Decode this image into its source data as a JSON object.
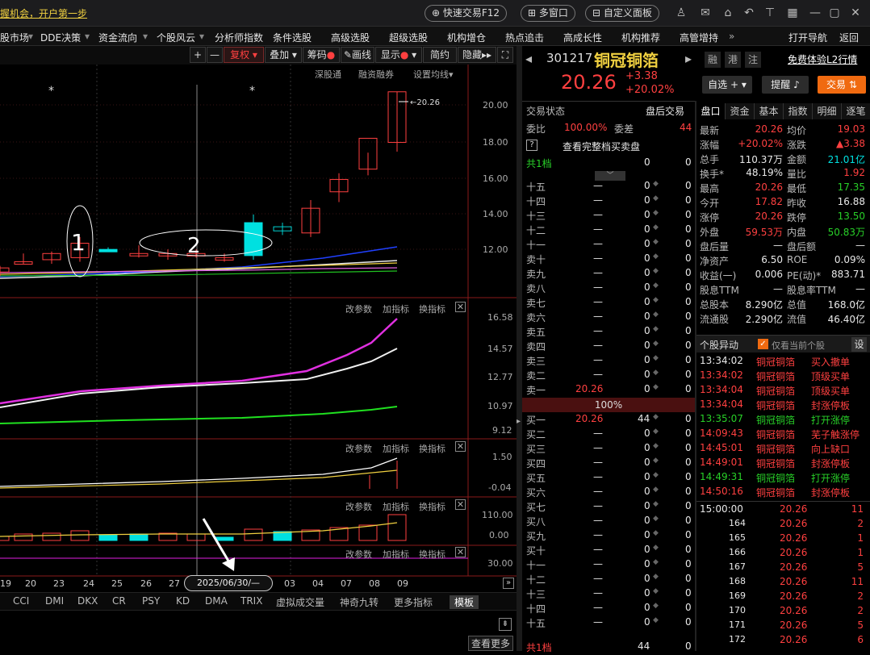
{
  "topbar": {
    "ad": "握机会，开户第一步",
    "fast_trade": "快速交易F12",
    "multi_window": "多窗口",
    "custom_panel": "自定义面板"
  },
  "menu": [
    "股市场",
    "DDE决策",
    "资金流向",
    "个股风云",
    "分析师指数",
    "条件选股",
    "高级选股",
    "超级选股",
    "机构增仓",
    "热点追击",
    "高成长性",
    "机构推荐",
    "高管增持",
    "打开导航",
    "返回"
  ],
  "chart_toolbar": {
    "plus": "+",
    "minus": "—",
    "fuquan": "复权",
    "diejia": "叠加",
    "chouma": "筹码",
    "huaxian": "画线",
    "xianshi": "显示",
    "jianyue": "简约",
    "yincang": "隐藏"
  },
  "chart_links": {
    "shengutong": "深股通",
    "rongzi": "融资融券",
    "junxian": "设置均线"
  },
  "pane_btns": {
    "gai": "改参数",
    "jia": "加指标",
    "huan": "换指标"
  },
  "price_labels": [
    "20.00",
    "18.00",
    "16.00",
    "14.00",
    "12.00"
  ],
  "last_price_label": "20.26",
  "ind1_labels": [
    "16.58",
    "14.57",
    "12.77",
    "10.97",
    "9.12"
  ],
  "ind2_labels": [
    "1.50",
    "-0.04"
  ],
  "ind3_labels": [
    "110.00",
    "0.00"
  ],
  "ind4_labels": [
    "30.00"
  ],
  "annotations": {
    "one": "1",
    "two": "2",
    "star": "*"
  },
  "x_axis": [
    "19",
    "20",
    "23",
    "24",
    "25",
    "26",
    "27",
    "03",
    "04",
    "07",
    "08",
    "09"
  ],
  "cursor_date": "2025/06/30/—",
  "indicators": [
    "CCI",
    "DMI",
    "DKX",
    "CR",
    "PSY",
    "KD",
    "DMA",
    "TRIX",
    "虚拟成交量",
    "神奇九转",
    "更多指标",
    "模板"
  ],
  "more": "查看更多",
  "stock": {
    "code": "301217",
    "name": "铜冠铜箔",
    "price": "20.26",
    "change": "+3.38",
    "pct": "+20.02%",
    "tags": [
      "融",
      "港",
      "注"
    ],
    "l2": "免费体验L2行情",
    "zixuan": "自选",
    "tixing": "提醒",
    "jiaoyi": "交易"
  },
  "ob": {
    "status_lbl": "交易状态",
    "status": "盘后交易",
    "weibi_lbl": "委比",
    "weibi": "100.00%",
    "weicha_lbl": "委差",
    "weicha": "44",
    "full": "查看完整档买卖盘",
    "gong1": "共1档",
    "ratio": "100%",
    "gong1b": "共1档",
    "asks": [
      [
        "十五",
        "—",
        "0"
      ],
      [
        "十四",
        "—",
        "0"
      ],
      [
        "十三",
        "—",
        "0"
      ],
      [
        "十二",
        "—",
        "0"
      ],
      [
        "十一",
        "—",
        "0"
      ],
      [
        "卖十",
        "—",
        "0"
      ],
      [
        "卖九",
        "—",
        "0"
      ],
      [
        "卖八",
        "—",
        "0"
      ],
      [
        "卖七",
        "—",
        "0"
      ],
      [
        "卖六",
        "—",
        "0"
      ],
      [
        "卖五",
        "—",
        "0"
      ],
      [
        "卖四",
        "—",
        "0"
      ],
      [
        "卖三",
        "—",
        "0"
      ],
      [
        "卖二",
        "—",
        "0"
      ],
      [
        "卖一",
        "20.26",
        "0"
      ]
    ],
    "bids": [
      [
        "买一",
        "20.26",
        "44"
      ],
      [
        "买二",
        "—",
        "0"
      ],
      [
        "买三",
        "—",
        "0"
      ],
      [
        "买四",
        "—",
        "0"
      ],
      [
        "买五",
        "—",
        "0"
      ],
      [
        "买六",
        "—",
        "0"
      ],
      [
        "买七",
        "—",
        "0"
      ],
      [
        "买八",
        "—",
        "0"
      ],
      [
        "买九",
        "—",
        "0"
      ],
      [
        "买十",
        "—",
        "0"
      ],
      [
        "十一",
        "—",
        "0"
      ],
      [
        "十二",
        "—",
        "0"
      ],
      [
        "十三",
        "—",
        "0"
      ],
      [
        "十四",
        "—",
        "0"
      ],
      [
        "十五",
        "—",
        "0"
      ]
    ]
  },
  "quote_tabs": [
    "盘口",
    "资金",
    "基本",
    "指数",
    "明细",
    "逐笔"
  ],
  "quote": [
    [
      "最新",
      "20.26",
      "均价",
      "19.03"
    ],
    [
      "涨幅",
      "+20.02%",
      "涨跌",
      "▲3.38"
    ],
    [
      "总手",
      "110.37万",
      "金额",
      "21.01亿"
    ],
    [
      "换手*",
      "48.19%",
      "量比",
      "1.92"
    ],
    [
      "最高",
      "20.26",
      "最低",
      "17.35"
    ],
    [
      "今开",
      "17.82",
      "昨收",
      "16.88"
    ],
    [
      "涨停",
      "20.26",
      "跌停",
      "13.50"
    ],
    [
      "外盘",
      "59.53万",
      "内盘",
      "50.83万"
    ],
    [
      "盘后量",
      "—",
      "盘后额",
      "—"
    ],
    [
      "净资产",
      "6.50",
      "ROE",
      "0.09%"
    ],
    [
      "收益(一)",
      "0.006",
      "PE(动)*",
      "883.71"
    ],
    [
      "股息TTM",
      "—",
      "股息率TTM",
      "—"
    ],
    [
      "总股本",
      "8.290亿",
      "总值",
      "168.0亿"
    ],
    [
      "流通股",
      "2.290亿",
      "流值",
      "46.40亿"
    ]
  ],
  "movers": {
    "title": "个股异动",
    "only": "仅看当前个股",
    "set": "设",
    "rows": [
      [
        "13:34:02",
        "铜冠铜箔",
        "买入撤单"
      ],
      [
        "13:34:02",
        "铜冠铜箔",
        "顶级买单"
      ],
      [
        "13:34:04",
        "铜冠铜箔",
        "顶级买单"
      ],
      [
        "13:34:04",
        "铜冠铜箔",
        "封涨停板"
      ],
      [
        "13:35:07",
        "铜冠铜箔",
        "打开涨停"
      ],
      [
        "14:09:43",
        "铜冠铜箔",
        "芜子触涨停"
      ],
      [
        "14:45:01",
        "铜冠铜箔",
        "向上缺口"
      ],
      [
        "14:49:01",
        "铜冠铜箔",
        "封涨停板"
      ],
      [
        "14:49:31",
        "铜冠铜箔",
        "打开涨停"
      ],
      [
        "14:50:16",
        "铜冠铜箔",
        "封涨停板"
      ]
    ]
  },
  "ticks": [
    [
      "15:00:00",
      "20.26",
      "11"
    ],
    [
      "164",
      "20.26",
      "2"
    ],
    [
      "165",
      "20.26",
      "1"
    ],
    [
      "166",
      "20.26",
      "1"
    ],
    [
      "167",
      "20.26",
      "5"
    ],
    [
      "168",
      "20.26",
      "11"
    ],
    [
      "169",
      "20.26",
      "2"
    ],
    [
      "170",
      "20.26",
      "2"
    ],
    [
      "171",
      "20.26",
      "5"
    ],
    [
      "172",
      "20.26",
      "6"
    ]
  ],
  "chart_data": {
    "type": "candlestick",
    "title": "",
    "xlabel": "",
    "ylabel": "",
    "x": [
      "19",
      "20",
      "23",
      "24",
      "25",
      "26",
      "27",
      "30",
      "03",
      "04",
      "07",
      "08",
      "09"
    ],
    "ohlc": [
      [
        11.5,
        11.8,
        11.3,
        11.7
      ],
      [
        12.0,
        12.4,
        11.9,
        11.9
      ],
      [
        12.1,
        12.5,
        11.9,
        12.4
      ],
      [
        12.2,
        13.2,
        12.0,
        12.9
      ],
      [
        12.6,
        12.7,
        12.5,
        12.6
      ],
      [
        12.4,
        12.8,
        12.2,
        12.4
      ],
      [
        12.3,
        12.6,
        12.1,
        12.4
      ],
      [
        12.4,
        12.6,
        12.2,
        12.4
      ],
      [
        12.2,
        12.4,
        12.0,
        12.1
      ],
      [
        12.3,
        14.3,
        12.1,
        13.9
      ],
      [
        13.7,
        13.9,
        13.3,
        13.5
      ],
      [
        13.4,
        15.0,
        13.2,
        14.6
      ],
      [
        15.4,
        16.3,
        14.9,
        16.0
      ],
      [
        16.5,
        17.3,
        16.2,
        18.0
      ],
      [
        17.8,
        20.26,
        17.35,
        20.26
      ]
    ],
    "ylim": [
      11.0,
      20.8
    ]
  }
}
